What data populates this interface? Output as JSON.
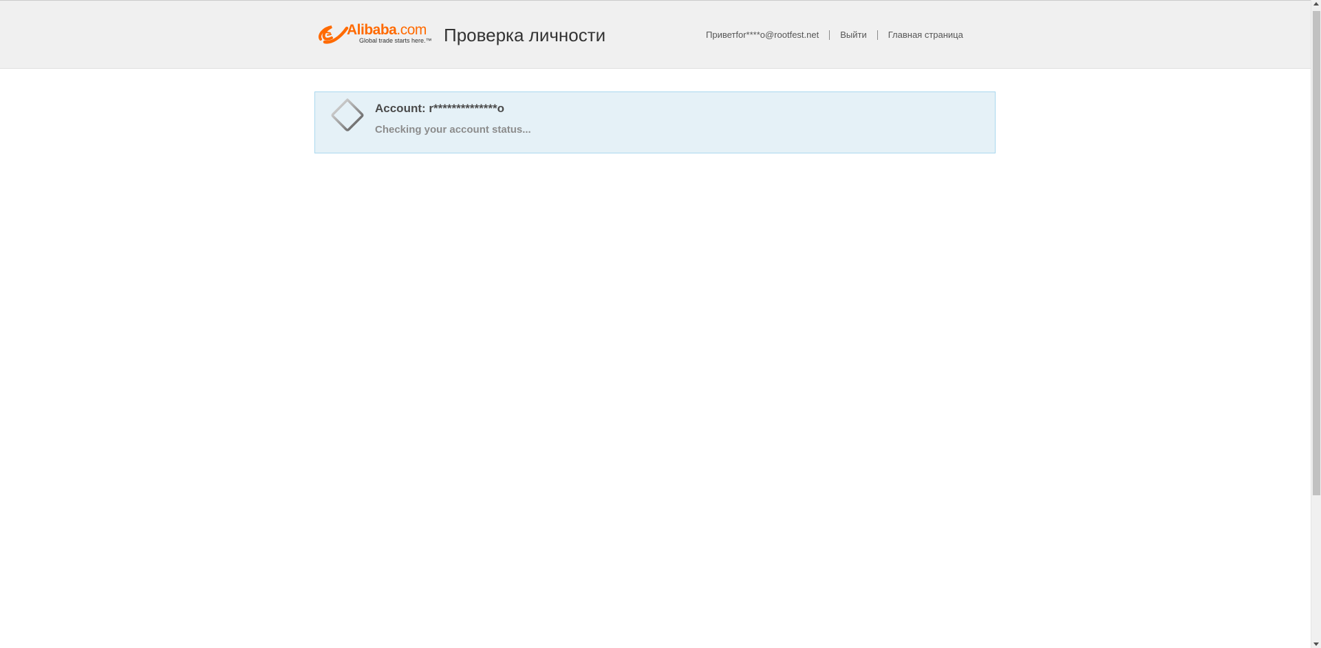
{
  "header": {
    "logo": {
      "icon": "alibaba-smile-icon",
      "wordmark": "Alibaba",
      "wordmark_suffix": ".com",
      "tagline": "Global trade starts here.™",
      "brand_color": "#ff6a00"
    },
    "page_title": "Проверка личности",
    "nav": {
      "greeting": "Приветfor****o@rootfest.net",
      "logout": "Выйти",
      "home": "Главная страница"
    }
  },
  "status": {
    "icon": "loading-spinner-icon",
    "account_label": "Account: r**************o",
    "message": "Checking your account status...",
    "background": "#e5f1f7",
    "border": "#a9d7ee"
  }
}
